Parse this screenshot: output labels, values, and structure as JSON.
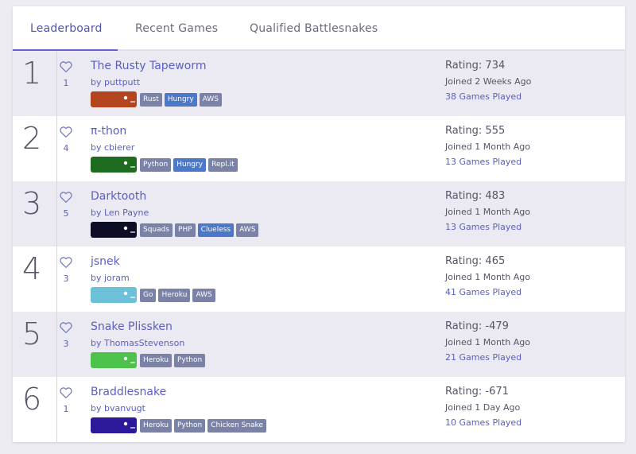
{
  "tabs": [
    {
      "label": "Leaderboard",
      "active": true
    },
    {
      "label": "Recent Games",
      "active": false
    },
    {
      "label": "Qualified Battlesnakes",
      "active": false
    }
  ],
  "colors": {
    "accent": "#5a5fc0",
    "tag_default": "#7a82a8",
    "tag_highlight": "#4b78c9"
  },
  "rows": [
    {
      "rank": "1",
      "likes": "1",
      "name": "The Rusty Tapeworm",
      "author": "by puttputt",
      "avatar_color": "#b4461f",
      "tags": [
        {
          "label": "Rust",
          "color": "#7a82a8"
        },
        {
          "label": "Hungry",
          "color": "#4b78c9"
        },
        {
          "label": "AWS",
          "color": "#7a82a8"
        }
      ],
      "rating": "Rating: 734",
      "joined": "Joined 2 Weeks Ago",
      "games": "38 Games Played"
    },
    {
      "rank": "2",
      "likes": "4",
      "name": "π-thon",
      "author": "by cbierer",
      "avatar_color": "#1f6b1f",
      "tags": [
        {
          "label": "Python",
          "color": "#7a82a8"
        },
        {
          "label": "Hungry",
          "color": "#4b78c9"
        },
        {
          "label": "Repl.it",
          "color": "#7a82a8"
        }
      ],
      "rating": "Rating: 555",
      "joined": "Joined 1 Month Ago",
      "games": "13 Games Played"
    },
    {
      "rank": "3",
      "likes": "5",
      "name": "Darktooth",
      "author": "by Len Payne",
      "avatar_color": "#0d0d26",
      "tags": [
        {
          "label": "Squads",
          "color": "#7a82a8"
        },
        {
          "label": "PHP",
          "color": "#7a82a8"
        },
        {
          "label": "Clueless",
          "color": "#4b78c9"
        },
        {
          "label": "AWS",
          "color": "#7a82a8"
        }
      ],
      "rating": "Rating: 483",
      "joined": "Joined 1 Month Ago",
      "games": "13 Games Played"
    },
    {
      "rank": "4",
      "likes": "3",
      "name": "jsnek",
      "author": "by joram",
      "avatar_color": "#6cc0d8",
      "tags": [
        {
          "label": "Go",
          "color": "#7a82a8"
        },
        {
          "label": "Heroku",
          "color": "#7a82a8"
        },
        {
          "label": "AWS",
          "color": "#7a82a8"
        }
      ],
      "rating": "Rating: 465",
      "joined": "Joined 1 Month Ago",
      "games": "41 Games Played"
    },
    {
      "rank": "5",
      "likes": "3",
      "name": "Snake Plissken",
      "author": "by ThomasStevenson",
      "avatar_color": "#4cc24a",
      "tags": [
        {
          "label": "Heroku",
          "color": "#7a82a8"
        },
        {
          "label": "Python",
          "color": "#7a82a8"
        }
      ],
      "rating": "Rating: -479",
      "joined": "Joined 1 Month Ago",
      "games": "21 Games Played"
    },
    {
      "rank": "6",
      "likes": "1",
      "name": "Braddlesnake",
      "author": "by bvanvugt",
      "avatar_color": "#2a1a9a",
      "tags": [
        {
          "label": "Heroku",
          "color": "#7a82a8"
        },
        {
          "label": "Python",
          "color": "#7a82a8"
        },
        {
          "label": "Chicken Snake",
          "color": "#7a82a8"
        }
      ],
      "rating": "Rating: -671",
      "joined": "Joined 1 Day Ago",
      "games": "10 Games Played"
    }
  ]
}
